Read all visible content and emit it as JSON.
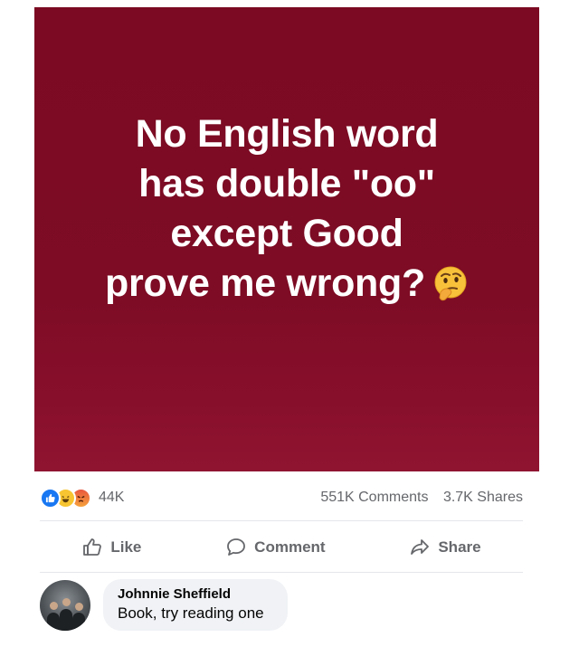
{
  "post": {
    "image": {
      "background_color": "#7d0c24",
      "text_lines": [
        "No English word",
        "has double \"oo\"",
        "except Good",
        "prove me wrong?"
      ],
      "trailing_emoji": "thinking-face-emoji"
    },
    "stats": {
      "reaction_icons": [
        "like-icon",
        "haha-icon",
        "angry-icon"
      ],
      "reaction_count": "44K",
      "comments": "551K Comments",
      "shares": "3.7K Shares"
    },
    "actions": {
      "like": "Like",
      "comment": "Comment",
      "share": "Share"
    },
    "comment": {
      "author": "Johnnie Sheffield",
      "text": "Book, try reading one"
    }
  },
  "colors": {
    "accent_blue": "#1877f2",
    "muted_text": "#65676b",
    "comment_bubble": "#f0f2f5"
  }
}
